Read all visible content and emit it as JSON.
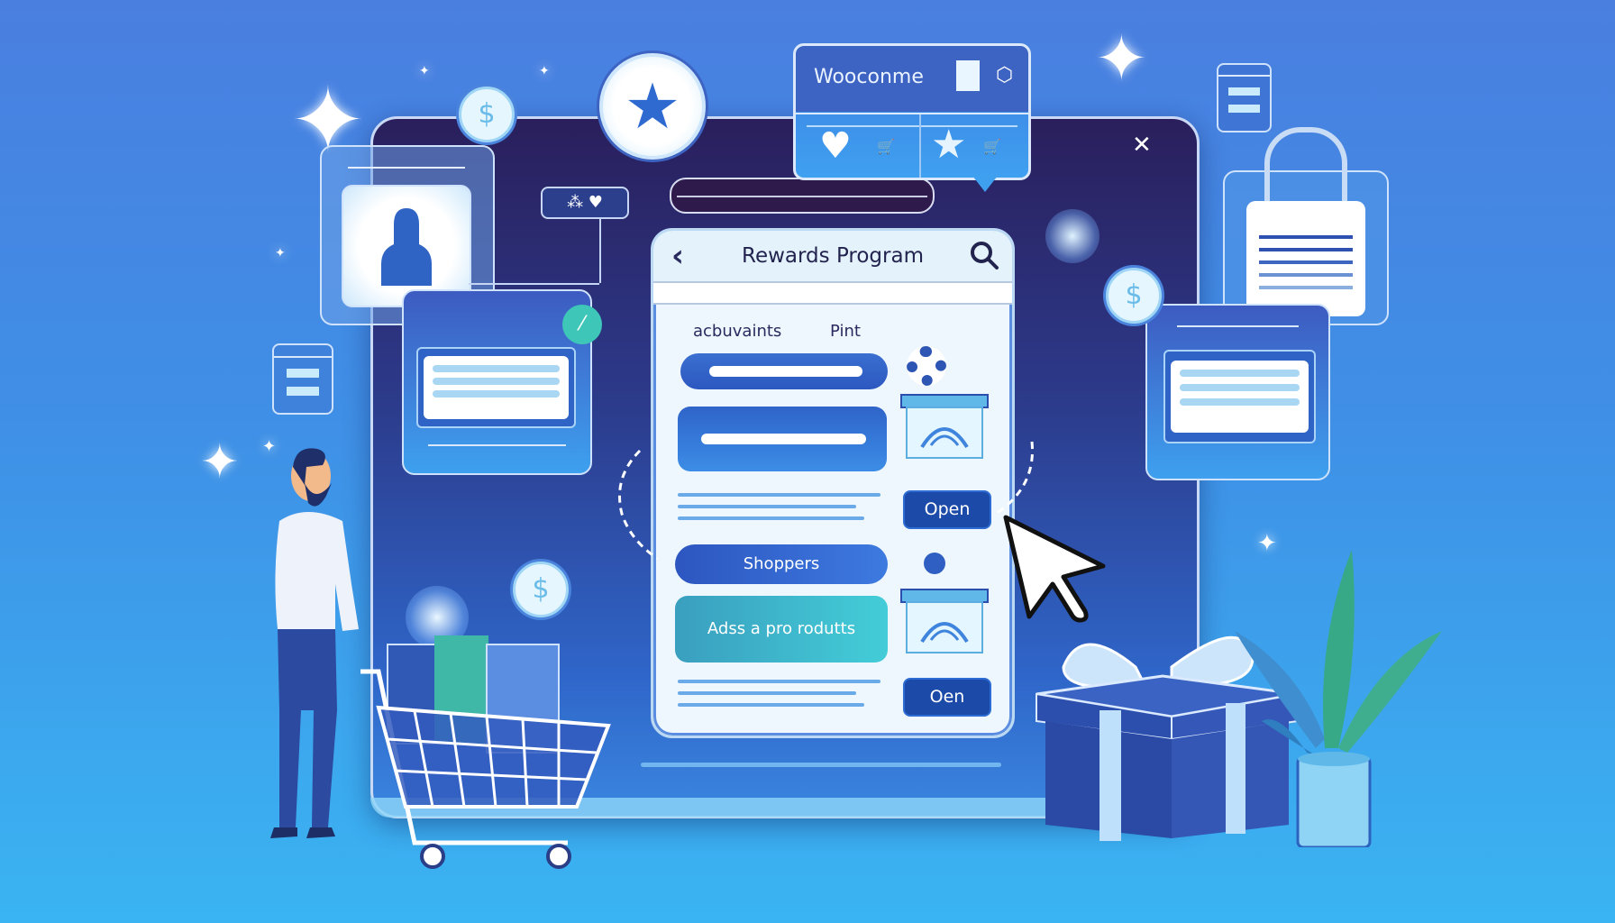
{
  "monitor": {
    "close_icon_glyph": "✕"
  },
  "popup": {
    "title": "Wooconme",
    "actions": [
      {
        "icon": "heart-icon",
        "glyph": "♥",
        "cart_glyph": "🛒"
      },
      {
        "icon": "star-icon",
        "glyph": "★",
        "cart_glyph": "🛒"
      }
    ]
  },
  "rewards_panel": {
    "title": "Rewards Program",
    "back_glyph": "‹",
    "column_labels": [
      "acbuvaints",
      "Pint"
    ],
    "items": [
      {
        "type": "pill",
        "label": ""
      },
      {
        "type": "card",
        "label": ""
      },
      {
        "type": "button",
        "label": "Open"
      },
      {
        "type": "pill",
        "label": "Shoppers"
      },
      {
        "type": "card",
        "label": "Adss a pro rodutts"
      },
      {
        "type": "button",
        "label": "Oen"
      }
    ]
  },
  "badges": {
    "star_badge": "★",
    "coin_glyph": "$",
    "link_badge_glyphs": "⁂ ♥"
  },
  "colors": {
    "accent": "#1c4aa8",
    "teal": "#3ec7b8",
    "panel_bg": "#eef7fd",
    "background_top": "#4a7fe0",
    "background_bottom": "#3ab4f2"
  }
}
